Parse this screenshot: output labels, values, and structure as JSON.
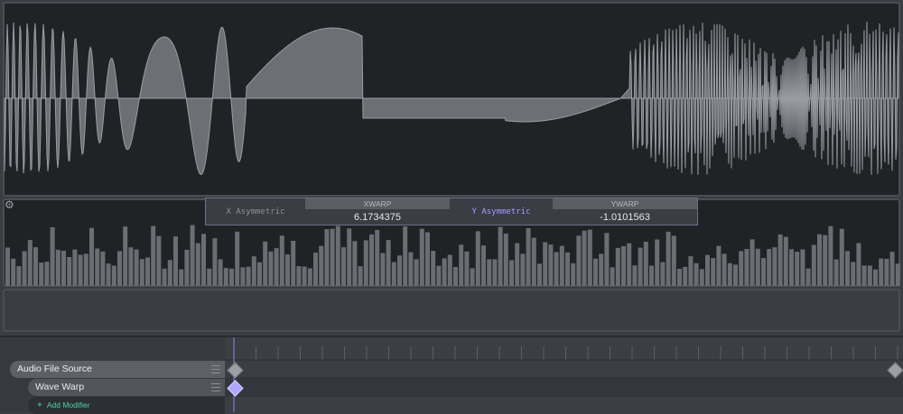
{
  "params": {
    "x_mode": "X Asymmetric",
    "xwarp_label": "XWARP",
    "xwarp_value": "6.1734375",
    "y_mode": "Y Asymmetric",
    "ywarp_label": "YWARP",
    "ywarp_value": "-1.0101563"
  },
  "tracks": {
    "source_label": "Audio File Source",
    "modifier_label": "Wave Warp",
    "add_modifier_label": "Add Modifier"
  },
  "colors": {
    "wave_fill": "#6c6f74",
    "accent_purple": "#a79cff",
    "add_green": "#48d6a8"
  },
  "icons": {
    "settings": "gear-icon",
    "add": "plus-icon",
    "drag": "drag-handle-icon",
    "keyframe": "diamond-keyframe-icon"
  }
}
